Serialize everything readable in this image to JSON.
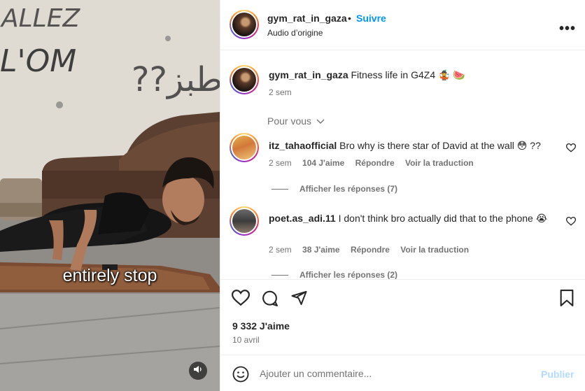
{
  "video": {
    "caption": "entirely stop",
    "wall_text_line1": "ALLEZ",
    "wall_text_line2": "L'OM",
    "wall_text_right": "??طبز"
  },
  "header": {
    "username": "gym_rat_in_gaza",
    "separator": "•",
    "follow_label": "Suivre",
    "audio_label": "Audio d’origine",
    "more_label": "•••"
  },
  "caption_post": {
    "username": "gym_rat_in_gaza",
    "text": "Fitness life in G4Z4 🤹 🍉",
    "age": "2 sem"
  },
  "sort_label": "Pour vous",
  "comments": [
    {
      "username": "itz_tahaofficial",
      "text": "Bro why is there star of David at the wall 😳 ??",
      "age": "2 sem",
      "likes": "104 J'aime",
      "reply_label": "Répondre",
      "translate_label": "Voir la traduction",
      "replies_label": "Afficher les réponses (7)"
    },
    {
      "username": "poet.as_adi.11",
      "text": "I don't think bro actually did that to the phone 😭",
      "age": "2 sem",
      "likes": "38 J'aime",
      "reply_label": "Répondre",
      "translate_label": "Voir la traduction",
      "replies_label": "Afficher les réponses (2)"
    }
  ],
  "actions": {
    "like_icon": "heart-icon",
    "comment_icon": "comment-icon",
    "share_icon": "paper-plane-icon",
    "save_icon": "bookmark-icon",
    "likes_count": "9 332 J'aime",
    "date": "10 avril"
  },
  "add_comment": {
    "placeholder": "Ajouter un commentaire...",
    "publish_label": "Publier"
  },
  "colors": {
    "accent": "#0095f6",
    "publish_disabled": "#b3dbff",
    "secondary_text": "#737373"
  }
}
